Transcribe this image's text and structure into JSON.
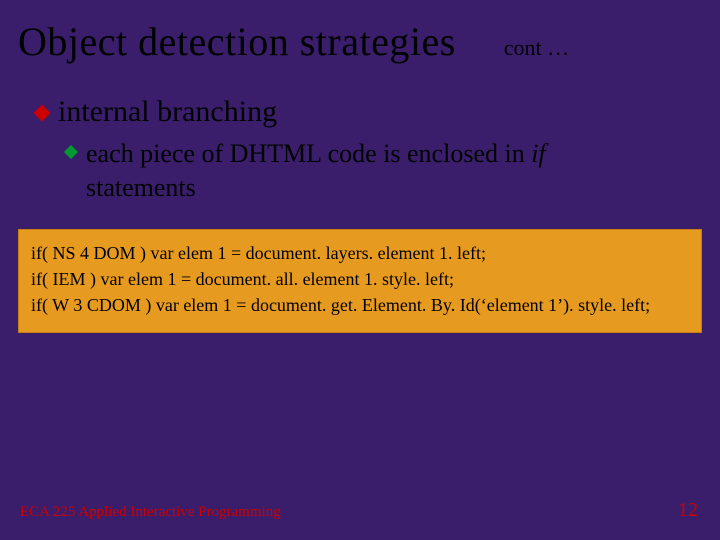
{
  "title": "Object detection strategies",
  "cont": "cont …",
  "bullet1": "internal branching",
  "bullet2_pre": "each piece of DHTML code is enclosed in ",
  "bullet2_if": "if",
  "bullet2_post": "statements",
  "code": {
    "l1": "if( NS 4 DOM ) var elem 1 = document. layers. element 1. left;",
    "l2": "if( IEM ) var elem 1 = document. all. element 1. style. left;",
    "l3": "if( W 3 CDOM ) var elem 1 = document. get. Element. By. Id(‘element 1’). style. left;"
  },
  "footer": {
    "course": "ECA 225   Applied Interactive Programming",
    "page": "12"
  }
}
